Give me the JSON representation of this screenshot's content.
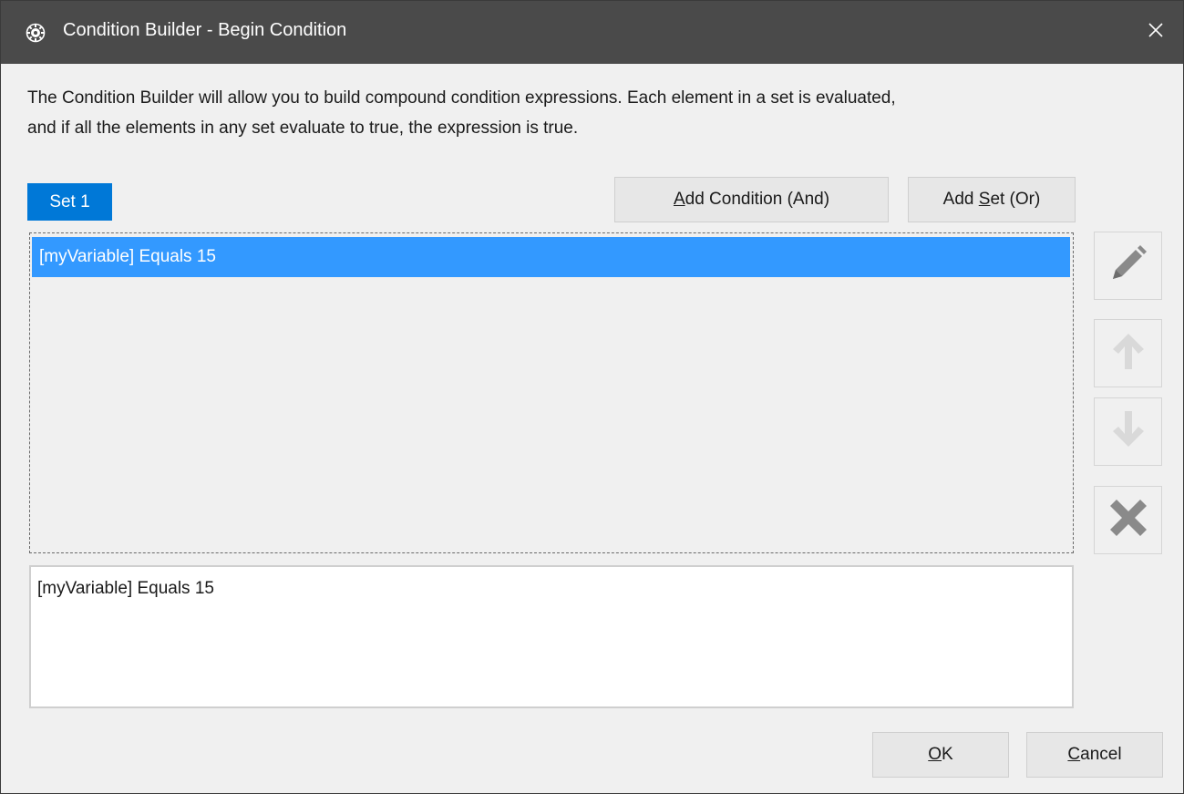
{
  "window": {
    "title": "Condition Builder - Begin Condition",
    "icon": "app-gear-icon",
    "close_icon": "close-icon"
  },
  "description": {
    "line1": "The Condition Builder will allow you to build compound condition expressions.  Each element in a set is evaluated,",
    "line2": "and if all the elements in any set evaluate to true, the expression is true."
  },
  "sets": {
    "tabs": [
      {
        "label": "Set 1",
        "selected": true
      }
    ]
  },
  "toolbar": {
    "add_condition": {
      "mnemonic": "A",
      "rest": "dd Condition (And)"
    },
    "add_set": {
      "before": "Add ",
      "mnemonic": "S",
      "rest": "et (Or)"
    }
  },
  "conditions": {
    "items": [
      {
        "label": "[myVariable] Equals 15",
        "selected": true
      }
    ]
  },
  "side_buttons": {
    "edit_icon": "pencil-icon",
    "up_icon": "arrow-up-icon",
    "down_icon": "arrow-down-icon",
    "delete_icon": "delete-x-icon"
  },
  "preview": {
    "text": "[myVariable] Equals 15"
  },
  "footer": {
    "ok": {
      "mnemonic": "O",
      "rest": "K"
    },
    "cancel": {
      "mnemonic": "C",
      "rest": "ancel"
    }
  },
  "colors": {
    "titlebar": "#4a4a4a",
    "accent": "#0078d7",
    "selection": "#3399ff",
    "disabled_icon": "#d9d9d9",
    "icon_gray": "#8a8a8a"
  }
}
